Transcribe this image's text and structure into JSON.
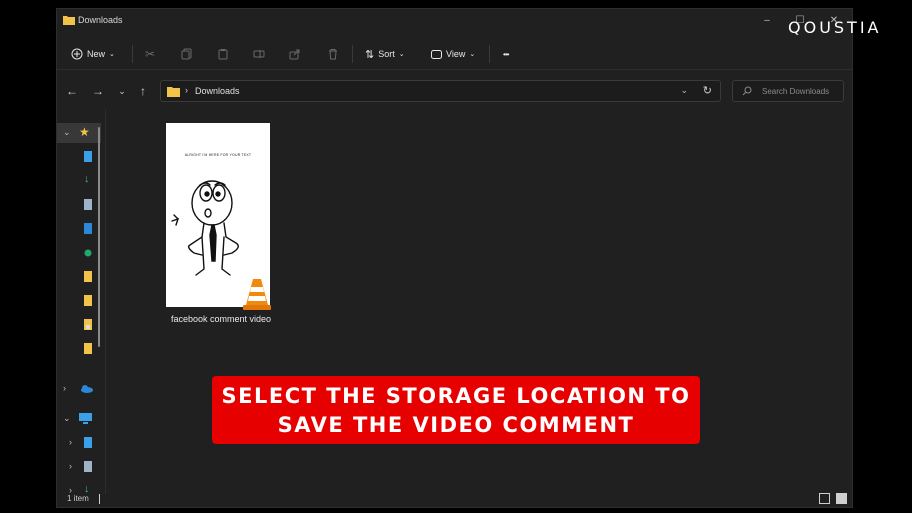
{
  "window": {
    "title": "Downloads"
  },
  "window_controls": [
    "–",
    "☐",
    "✕"
  ],
  "toolbar": {
    "new_label": "New",
    "sort_label": "Sort",
    "view_label": "View",
    "more_label": "•••"
  },
  "address": {
    "path": "Downloads",
    "separator": "›"
  },
  "search": {
    "placeholder": "Search Downloads"
  },
  "file": {
    "name": "facebook comment video",
    "thumbnail_text": "ALRIGHT I'M HERE FOR YOUR TEXT"
  },
  "status": {
    "item_count": "1 item"
  },
  "overlay": {
    "line1": "SELECT THE STORAGE LOCATION TO",
    "line2": "SAVE THE VIDEO COMMENT",
    "color": "#e60000"
  },
  "brand": {
    "name": "QOUSTIA"
  }
}
